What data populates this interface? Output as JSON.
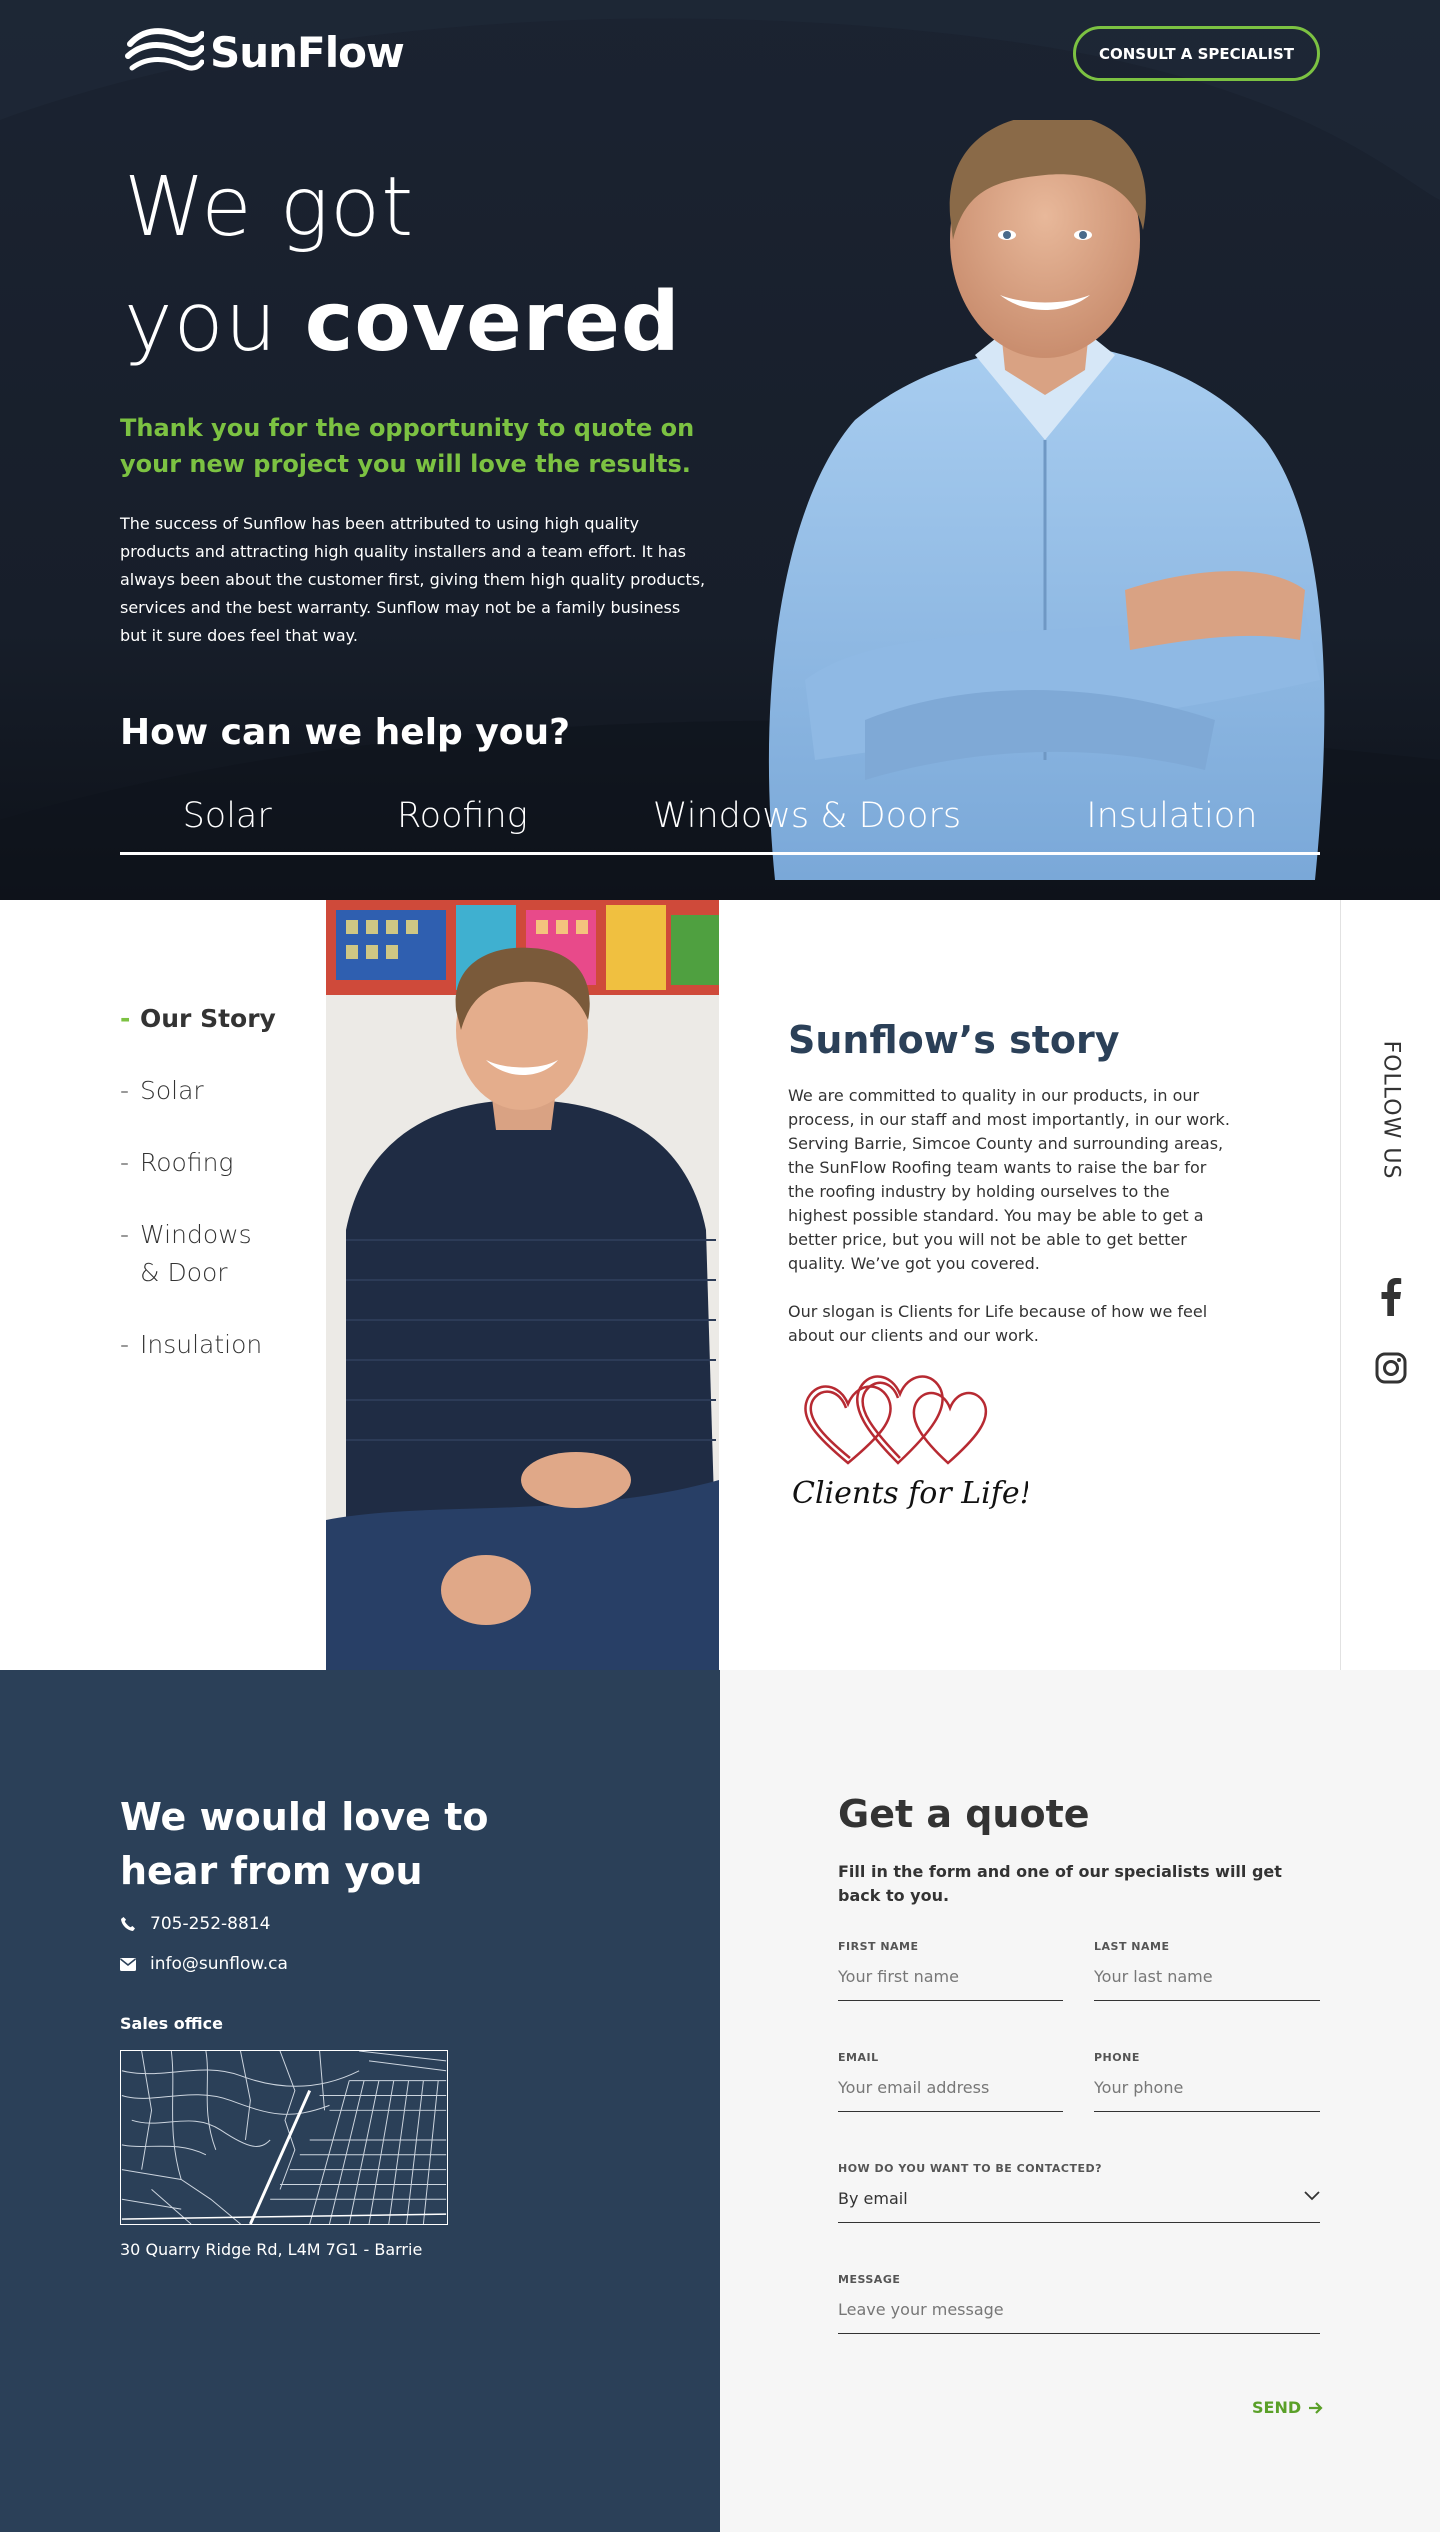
{
  "brand": {
    "name": "SunFlow",
    "accent": "#7cc242",
    "navy": "#2b4058",
    "dark": "#1a2230"
  },
  "header": {
    "cta_label": "CONSULT A SPECIALIST"
  },
  "hero": {
    "title_line1": "We got",
    "title_line2_light": "you",
    "title_line2_bold": "covered",
    "subtitle": "Thank you for the opportunity to quote on your new project you will love the results.",
    "body": "The success of Sunflow has been attributed to using high quality products and attracting high quality installers and a team effort. It has always been about the customer first, giving them high quality products, services and the best warranty. Sunflow may not be a family business but it sure does feel that way.",
    "help_title": "How can we help you?",
    "services": [
      "Solar",
      "Roofing",
      "Windows & Doors",
      "Insulation"
    ]
  },
  "story": {
    "nav": [
      {
        "label": "Our Story",
        "active": true
      },
      {
        "label": "Solar",
        "active": false
      },
      {
        "label": "Roofing",
        "active": false
      },
      {
        "label": "Windows & Door",
        "active": false
      },
      {
        "label": "Insulation",
        "active": false
      }
    ],
    "title": "Sunflow’s story",
    "paragraph1": "We are committed to quality in our products, in our process, in our staff and most importantly, in our work. Serving Barrie, Simcoe County and surrounding areas, the SunFlow Roofing team wants to raise the bar for the roofing industry by holding ourselves to the highest possible standard. You may be able to get a better price, but you will not be able to get better quality. We’ve got you covered.",
    "paragraph2": "Our slogan is Clients for Life because of how we feel about our clients and our work.",
    "slogan_text": "Clients for Life!",
    "follow_label": "FOLLOW US",
    "social_icons": [
      "facebook-icon",
      "instagram-icon"
    ]
  },
  "contact": {
    "title": "We would love to hear from you",
    "phone": "705-252-8814",
    "email": "info@sunflow.ca",
    "sales_label": "Sales office",
    "address": "30 Quarry Ridge Rd, L4M 7G1 - Barrie"
  },
  "quote": {
    "title": "Get a quote",
    "subtitle": "Fill in the form and one of our specialists will get back to you.",
    "first_name": {
      "label": "FIRST NAME",
      "placeholder": "Your first name"
    },
    "last_name": {
      "label": "LAST NAME",
      "placeholder": "Your last name"
    },
    "email": {
      "label": "EMAIL",
      "placeholder": "Your email address"
    },
    "phone": {
      "label": "PHONE",
      "placeholder": "Your phone"
    },
    "contact_method": {
      "label": "HOW DO YOU WANT TO BE CONTACTED?",
      "value": "By email"
    },
    "message": {
      "label": "MESSAGE",
      "placeholder": "Leave your message"
    },
    "send_label": "SEND"
  }
}
